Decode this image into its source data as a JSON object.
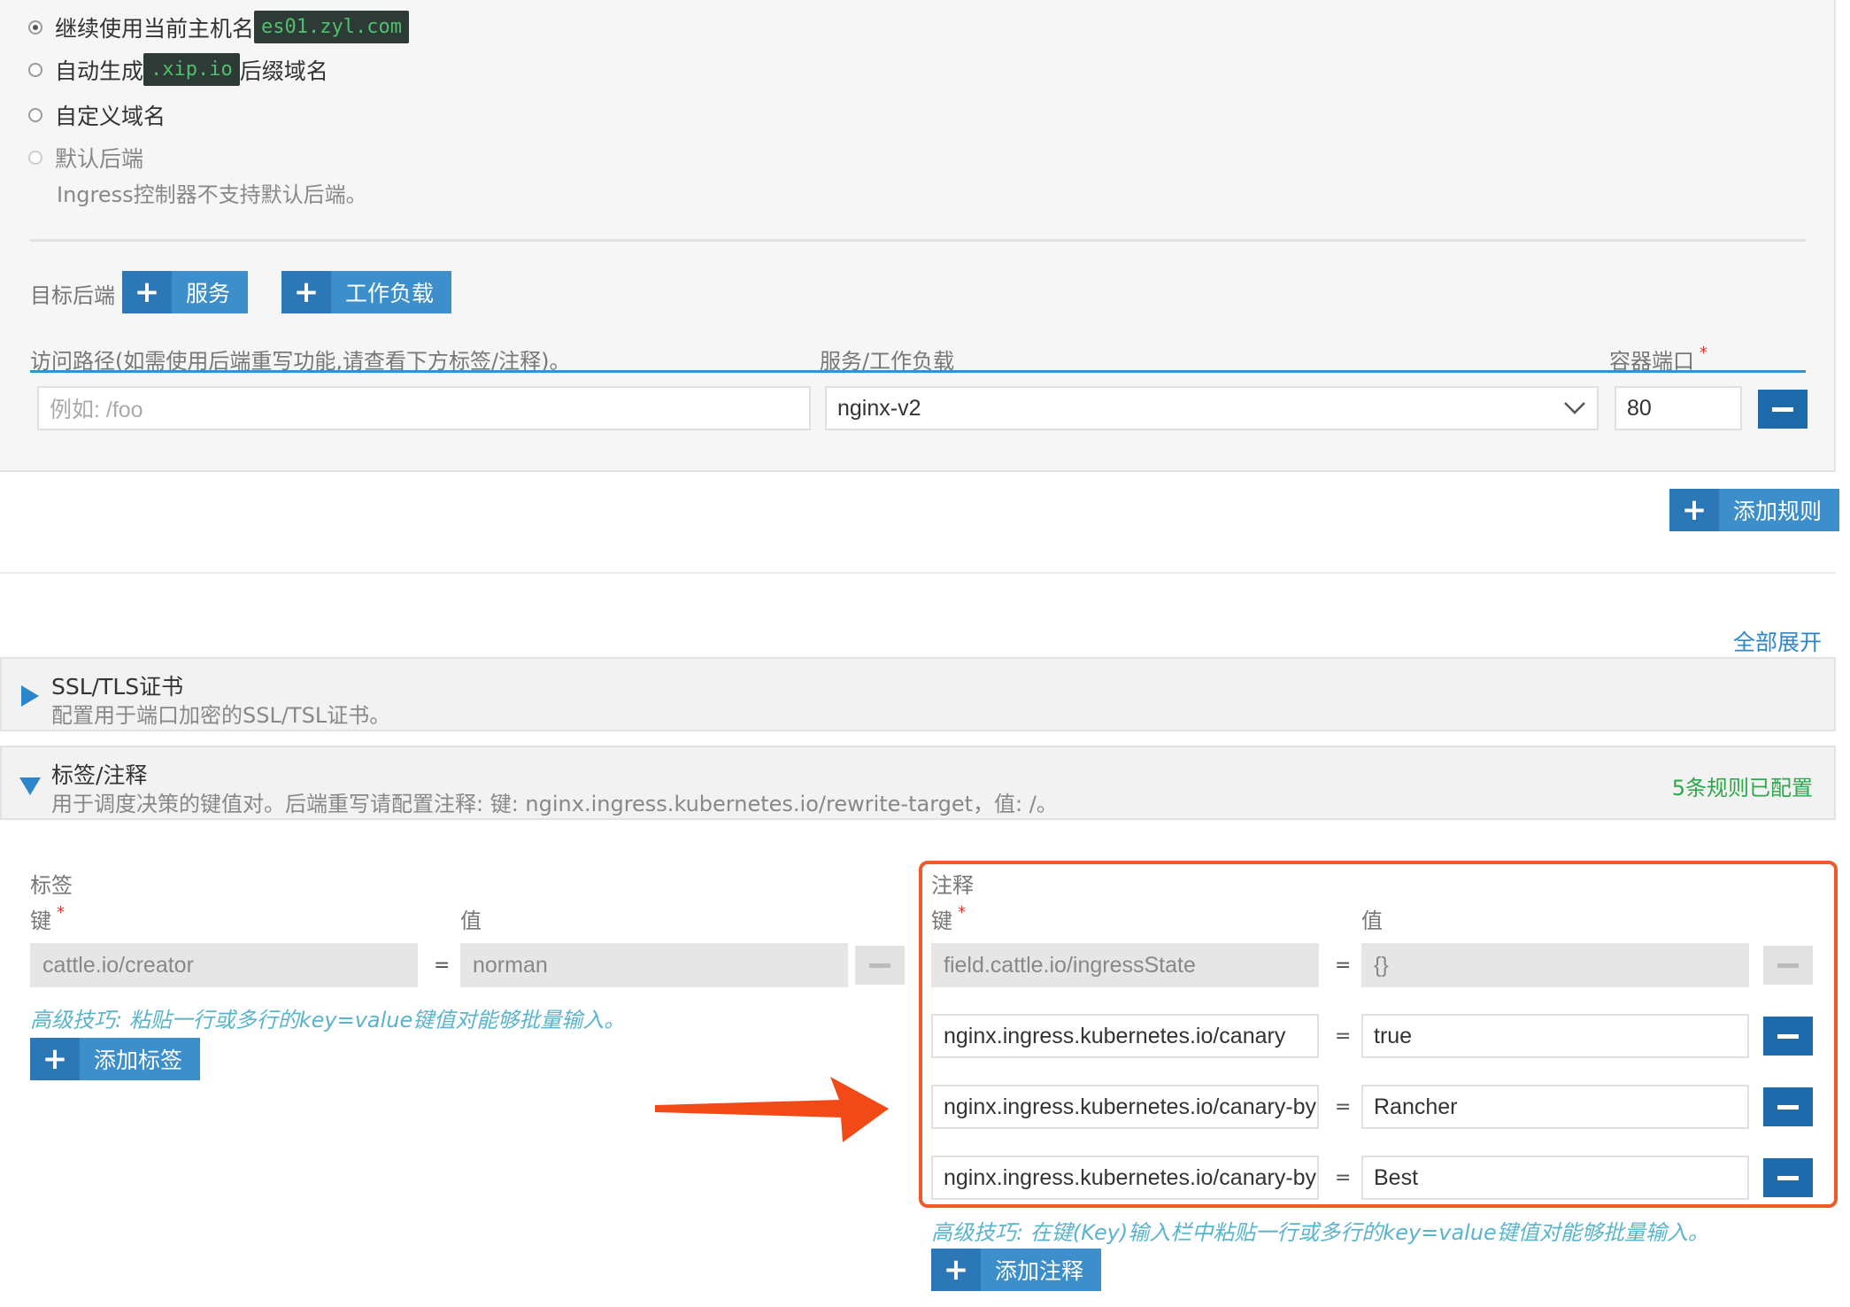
{
  "hostname_options": {
    "keep": {
      "label": "继续使用当前主机名",
      "code": "es01.zyl.com"
    },
    "auto": {
      "label_pre": "自动生成",
      "code": ".xip.io",
      "label_post": "后缀域名"
    },
    "custom": {
      "label": "自定义域名"
    },
    "default": {
      "label": "默认后端",
      "note": "Ingress控制器不支持默认后端。"
    }
  },
  "target": {
    "label": "目标后端",
    "service_button": "服务",
    "workload_button": "工作负载"
  },
  "rule_table": {
    "col_path": "访问路径(如需使用后端重写功能,请查看下方标签/注释)。",
    "col_service": "服务/工作负载",
    "col_port": "容器端口",
    "path_placeholder": "例如: /foo",
    "service_value": "nginx-v2",
    "port_value": "80"
  },
  "add_rule_button": "添加规则",
  "expand_all": "全部展开",
  "ssl_panel": {
    "title": "SSL/TLS证书",
    "description": "配置用于端口加密的SSL/TSL证书。"
  },
  "labels_panel": {
    "title": "标签/注释",
    "description": "用于调度决策的键值对。后端重写请配置注释: 键: nginx.ingress.kubernetes.io/rewrite-target，值: /。",
    "status": "5条规则已配置"
  },
  "labels": {
    "heading": "标签",
    "key_header": "键",
    "value_header": "值",
    "rows": [
      {
        "key": "cattle.io/creator",
        "value": "norman"
      }
    ],
    "tip": "高级技巧: 粘贴一行或多行的key=value键值对能够批量输入。",
    "add_button": "添加标签"
  },
  "annotations": {
    "heading": "注释",
    "key_header": "键",
    "value_header": "值",
    "rows": [
      {
        "key": "field.cattle.io/ingressState",
        "value": "{}"
      },
      {
        "key": "nginx.ingress.kubernetes.io/canary",
        "value": "true"
      },
      {
        "key": "nginx.ingress.kubernetes.io/canary-by-header",
        "value": "Rancher"
      },
      {
        "key": "nginx.ingress.kubernetes.io/canary-by-header-value",
        "value": "Best"
      }
    ],
    "tip": "高级技巧: 在键(Key)输入栏中粘贴一行或多行的key=value键值对能够批量输入。",
    "add_button": "添加注释"
  },
  "colors": {
    "primary": "#3d8fcc",
    "highlight_box": "#f05a28",
    "arrow": "#f24a16",
    "status_green": "#2ea84a"
  },
  "icons": {
    "plus": "plus-icon",
    "minus": "minus-icon",
    "chevron": "chevron-down-icon"
  }
}
